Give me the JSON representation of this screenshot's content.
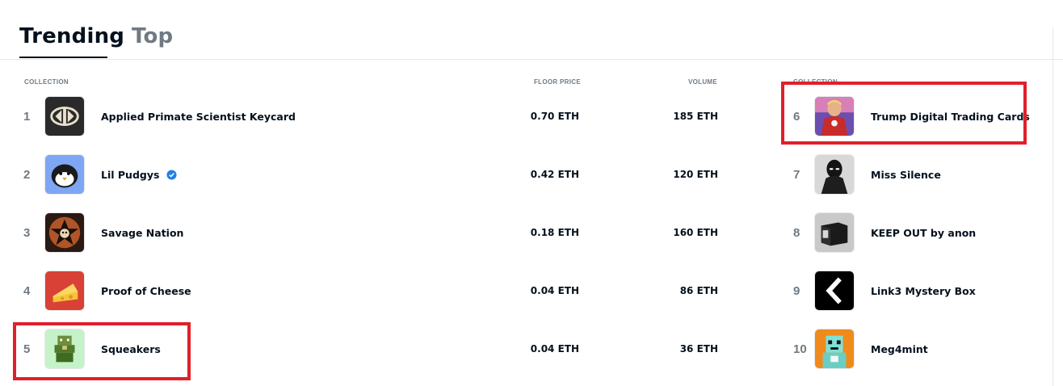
{
  "tabs": {
    "trending": "Trending",
    "top": "Top"
  },
  "columns": {
    "collection": "COLLECTION",
    "floor_price": "FLOOR PRICE",
    "volume": "VOLUME",
    "collection_right": "COLLECTION"
  },
  "left_rows": [
    {
      "rank": "1",
      "name": "Applied Primate Scientist Keycard",
      "floor": "0.70 ETH",
      "volume": "185 ETH",
      "icon": "keycard-logo-icon"
    },
    {
      "rank": "2",
      "name": "Lil Pudgys",
      "floor": "0.42 ETH",
      "volume": "120 ETH",
      "icon": "penguin-icon",
      "verified": true
    },
    {
      "rank": "3",
      "name": "Savage Nation",
      "floor": "0.18 ETH",
      "volume": "160 ETH",
      "icon": "star-skull-icon"
    },
    {
      "rank": "4",
      "name": "Proof of Cheese",
      "floor": "0.04 ETH",
      "volume": "86 ETH",
      "icon": "cheese-icon"
    },
    {
      "rank": "5",
      "name": "Squeakers",
      "floor": "0.04 ETH",
      "volume": "36 ETH",
      "icon": "pixel-creature-icon"
    }
  ],
  "right_rows": [
    {
      "rank": "6",
      "name": "Trump Digital Trading Cards",
      "icon": "superhero-portrait-icon"
    },
    {
      "rank": "7",
      "name": "Miss Silence",
      "icon": "dark-figure-icon"
    },
    {
      "rank": "8",
      "name": "KEEP OUT by anon",
      "icon": "black-cube-icon"
    },
    {
      "rank": "9",
      "name": "Link3 Mystery Box",
      "icon": "chevron-left-icon"
    },
    {
      "rank": "10",
      "name": "Meg4mint",
      "icon": "pixel-robot-icon"
    }
  ],
  "colors": {
    "highlight": "#e0202a",
    "verified": "#2081e2",
    "muted": "#707a83",
    "text": "#04111d"
  }
}
